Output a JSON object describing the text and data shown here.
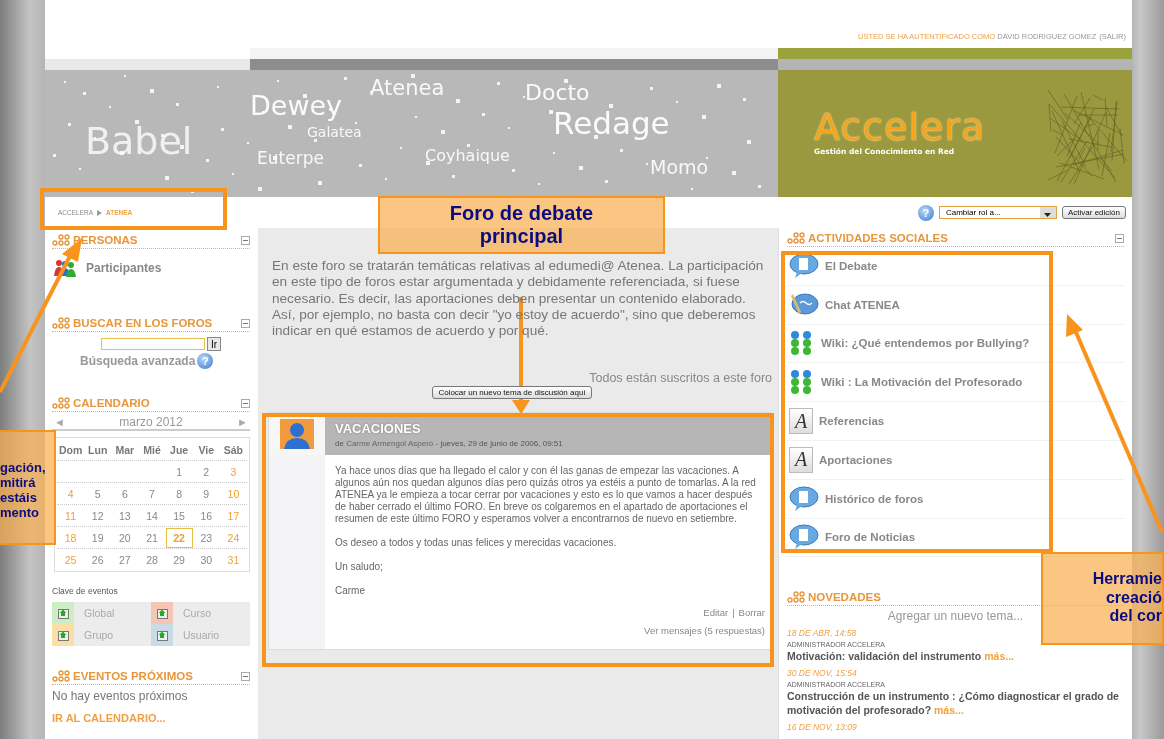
{
  "user_bar": {
    "prefix": "USTED SE HA AUTENTIFICADO COMO",
    "user": "DAVID RODRIGUEZ GOMEZ",
    "logout": "(SALIR)"
  },
  "banner": {
    "words": [
      "Babel",
      "Dewey",
      "Atenea",
      "Galatea",
      "Docto",
      "Redage",
      "Euterpe",
      "Coyhaique",
      "Momo"
    ],
    "logo": "Accelera",
    "tagline": "Gestión del Conocimiento en Red"
  },
  "breadcrumb": [
    "ACCELERA",
    "ATENEA"
  ],
  "tools": {
    "help_glyph": "?",
    "role_select": "Cambiar rol a...",
    "edit_button": "Activar edición"
  },
  "left": {
    "personas": {
      "title": "PERSONAS",
      "item": "Participantes"
    },
    "search": {
      "title": "BUSCAR EN LOS FOROS",
      "button": "Ir",
      "advanced": "Búsqueda avanzada",
      "help_glyph": "?"
    },
    "calendar": {
      "title": "CALENDARIO",
      "prev": "◄",
      "month": "marzo 2012",
      "next": "►",
      "weekdays": [
        "Dom",
        "Lun",
        "Mar",
        "Mié",
        "Jue",
        "Vie",
        "Sáb"
      ],
      "weeks": [
        [
          {
            "day": "1",
            "today": false
          },
          {
            "day": "2",
            "today": false
          },
          {
            "day": "3",
            "today": false
          }
        ],
        [
          {
            "day": "4",
            "today": false
          },
          {
            "day": "5",
            "today": false
          },
          {
            "day": "6",
            "today": false
          },
          {
            "day": "7",
            "today": false
          },
          {
            "day": "8",
            "today": false
          },
          {
            "day": "9",
            "today": false
          },
          {
            "day": "10",
            "today": false
          }
        ],
        [
          {
            "day": "11",
            "today": false
          },
          {
            "day": "12",
            "today": false
          },
          {
            "day": "13",
            "today": false
          },
          {
            "day": "14",
            "today": false
          },
          {
            "day": "15",
            "today": false
          },
          {
            "day": "16",
            "today": false
          },
          {
            "day": "17",
            "today": false
          }
        ],
        [
          {
            "day": "18",
            "today": false
          },
          {
            "day": "19",
            "today": false
          },
          {
            "day": "20",
            "today": false
          },
          {
            "day": "21",
            "today": false
          },
          {
            "day": "22",
            "today": true
          },
          {
            "day": "23",
            "today": false
          },
          {
            "day": "24",
            "today": false
          }
        ],
        [
          {
            "day": "25",
            "today": false
          },
          {
            "day": "26",
            "today": false
          },
          {
            "day": "27",
            "today": false
          },
          {
            "day": "28",
            "today": false
          },
          {
            "day": "29",
            "today": false
          },
          {
            "day": "30",
            "today": false
          },
          {
            "day": "31",
            "today": false
          }
        ]
      ]
    },
    "legend": {
      "title": "Clave de eventos",
      "items": [
        {
          "label": "Global",
          "color": "#cdeec4"
        },
        {
          "label": "Curso",
          "color": "#f6c6b4"
        },
        {
          "label": "Grupo",
          "color": "#fae0a6"
        },
        {
          "label": "Usuario",
          "color": "#c9dbe6"
        }
      ]
    },
    "upcoming": {
      "title": "EVENTOS PRÓXIMOS",
      "text": "No hay eventos próximos",
      "link": "IR AL CALENDARIO..."
    }
  },
  "middle": {
    "intro": "En este foro se tratarán temáticas relativas al edumedi@ Atenea.  La participación en este tipo de foros estar argumentada y debidamente referenciada, si fuese necesario. Es decir, las aportaciones deben presentar un contenido elaborado. Así, por ejemplo, no basta con decir \"yo estoy de acuerdo\", sino que deberemos indicar en qué estamos de acuerdo y por qué.",
    "subscribed": "Todos están suscritos a este foro",
    "new_topic_button": "Colocar un nuevo tema de discusión aquí",
    "post": {
      "title": "VACACIONES",
      "by": "de",
      "author": "Carme Armengol Asperó",
      "date": "- jueves, 29 de junio de 2006, 09:51",
      "paragraphs": [
        "Ya hace unos días que ha llegado el calor y con él las ganas de empezar las vacaciones. A algunos aún nos quedan algunos días pero quizás otros ya estéis a punto de tomarlas. A la red ATENEA ya le empieza a tocar cerrar por vacaciones y esto es lo que vamos a hacer después de haber cerrado el último FORO. En breve os colgaremos en el apartado de aportaciones  el resumen de este último FORO y esperamos volver a encontrarnos de nuevo en setiembre.",
        "Os deseo a todos y todas unas felices y merecidas vacaciones.",
        "Un saludo;",
        "Carme"
      ],
      "edit": "Editar",
      "separator": "|",
      "delete": "Borrar",
      "replies": "Ver mensajes (5 respuestas)"
    }
  },
  "right": {
    "activities": {
      "title": "ACTIVIDADES SOCIALES",
      "items": [
        {
          "kind": "forum",
          "label": "El Debate"
        },
        {
          "kind": "chat",
          "label": "Chat ATENEA"
        },
        {
          "kind": "wiki",
          "label": "Wiki: ¿Qué entendemos por Bullying?"
        },
        {
          "kind": "wiki",
          "label": "Wiki : La Motivación del Profesorado"
        },
        {
          "kind": "resource",
          "label": "Referencias",
          "glyph": "A"
        },
        {
          "kind": "resource",
          "label": "Aportaciones",
          "glyph": "A"
        },
        {
          "kind": "forum",
          "label": "Histórico de foros"
        },
        {
          "kind": "forum",
          "label": "Foro de Noticias"
        }
      ]
    },
    "news": {
      "title": "NOVEDADES",
      "add": "Agregar un nuevo tema...",
      "items": [
        {
          "date": "18 DE ABR, 14:58",
          "author": "ADMINISTRADOR ACCELERA",
          "text": "Motivación: validación del instrumento",
          "more": "más..."
        },
        {
          "date": "30 DE NOV, 15:54",
          "author": "ADMINISTRADOR ACCELERA",
          "text": "Construcción de un instrumento : ¿Cómo diagnosticar el grado de motivación del profesorado?",
          "more": "más..."
        },
        {
          "date": "16 DE NOV, 13:09"
        }
      ]
    }
  },
  "annotations": [
    {
      "lines": [
        "Foro de debate",
        "principal"
      ]
    },
    {
      "lines": [
        "gación,",
        "mitirá",
        "estáis",
        "mento"
      ]
    },
    {
      "lines": [
        "Herramie",
        "creació",
        "del cor"
      ]
    }
  ]
}
